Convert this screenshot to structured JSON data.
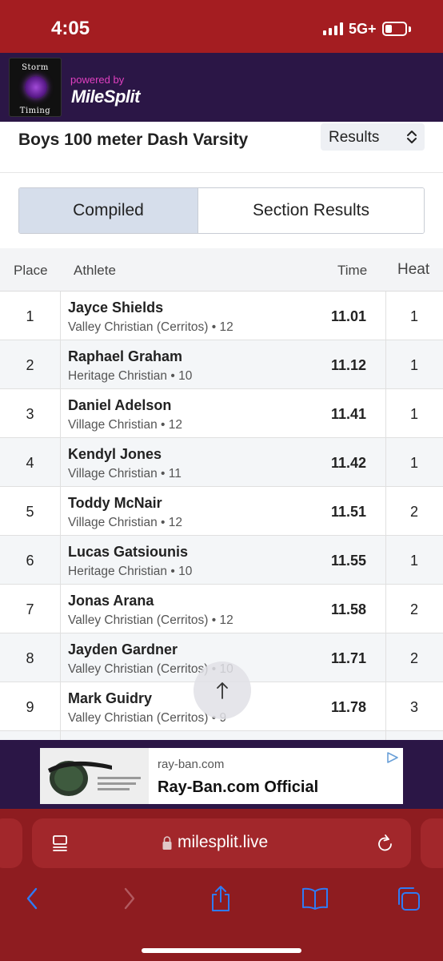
{
  "status_bar": {
    "time": "4:05",
    "network": "5G+"
  },
  "header": {
    "logo_top": "Storm",
    "logo_bottom": "Timing",
    "powered_by": "powered by",
    "brand": "MileSplit"
  },
  "event": {
    "title": "Boys 100 meter Dash Varsity",
    "view_select": "Results"
  },
  "tabs": [
    {
      "label": "Compiled",
      "active": true
    },
    {
      "label": "Section Results",
      "active": false
    }
  ],
  "table": {
    "headers": {
      "place": "Place",
      "athlete": "Athlete",
      "time": "Time",
      "heat": "Heat"
    },
    "rows": [
      {
        "place": "1",
        "name": "Jayce Shields",
        "school": "Valley Christian (Cerritos) • 12",
        "time": "11.01",
        "heat": "1"
      },
      {
        "place": "2",
        "name": "Raphael Graham",
        "school": "Heritage Christian • 10",
        "time": "11.12",
        "heat": "1"
      },
      {
        "place": "3",
        "name": "Daniel Adelson",
        "school": "Village Christian • 12",
        "time": "11.41",
        "heat": "1"
      },
      {
        "place": "4",
        "name": "Kendyl Jones",
        "school": "Village Christian • 11",
        "time": "11.42",
        "heat": "1"
      },
      {
        "place": "5",
        "name": "Toddy McNair",
        "school": "Village Christian • 12",
        "time": "11.51",
        "heat": "2"
      },
      {
        "place": "6",
        "name": "Lucas Gatsiounis",
        "school": "Heritage Christian • 10",
        "time": "11.55",
        "heat": "1"
      },
      {
        "place": "7",
        "name": "Jonas Arana",
        "school": "Valley Christian (Cerritos) • 12",
        "time": "11.58",
        "heat": "2"
      },
      {
        "place": "8",
        "name": "Jayden Gardner",
        "school": "Valley Christian (Cerritos) • 10",
        "time": "11.71",
        "heat": "2"
      },
      {
        "place": "9",
        "name": "Mark Guidry",
        "school": "Valley Christian (Cerritos) • 9",
        "time": "11.78",
        "heat": "3"
      }
    ]
  },
  "ad": {
    "domain": "ray-ban.com",
    "title": "Ray-Ban.com Official"
  },
  "browser": {
    "url": "milesplit.live"
  },
  "colors": {
    "status_bar": "#a41d21",
    "header": "#2b1646",
    "browser_chrome": "#8e1c20",
    "active_tab": "#d6deeb",
    "ios_blue": "#2f7bf5"
  }
}
